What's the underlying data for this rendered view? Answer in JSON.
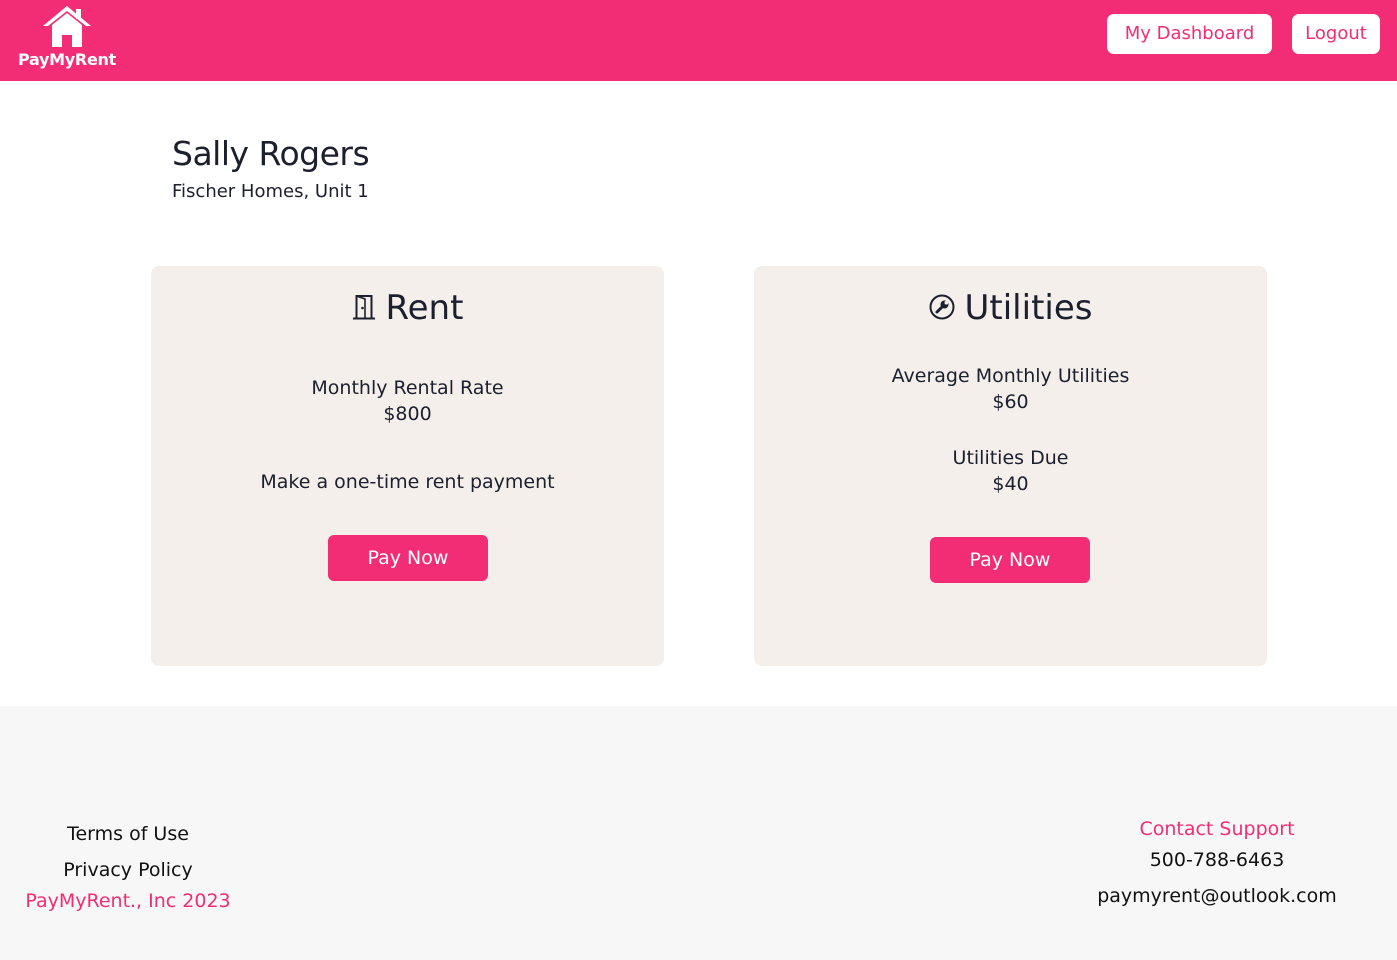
{
  "colors": {
    "brand": "#f22d75",
    "card_background": "#f4efea",
    "footer_background": "#f7f7f7",
    "text": "#1b1f2e"
  },
  "header": {
    "logo_text": "PayMyRent",
    "logo_icon": "house-icon",
    "nav": {
      "dashboard_label": "My Dashboard",
      "logout_label": "Logout"
    }
  },
  "profile": {
    "name": "Sally Rogers",
    "unit": "Fischer Homes, Unit 1"
  },
  "rent_card": {
    "icon": "door-icon",
    "title": "Rent",
    "rate_label": "Monthly Rental Rate",
    "rate_value": "$800",
    "one_time_label": "Make a one-time rent payment",
    "pay_label": "Pay Now"
  },
  "utilities_card": {
    "icon": "wrench-circle-icon",
    "title": "Utilities",
    "average_label": "Average Monthly Utilities",
    "average_value": "$60",
    "due_label": "Utilities Due",
    "due_value": "$40",
    "pay_label": "Pay Now"
  },
  "footer": {
    "terms_label": "Terms of Use",
    "privacy_label": "Privacy Policy",
    "copyright": "PayMyRent., Inc 2023",
    "contact_title": "Contact Support",
    "contact_phone": "500-788-6463",
    "contact_email": "paymyrent@outlook.com"
  }
}
